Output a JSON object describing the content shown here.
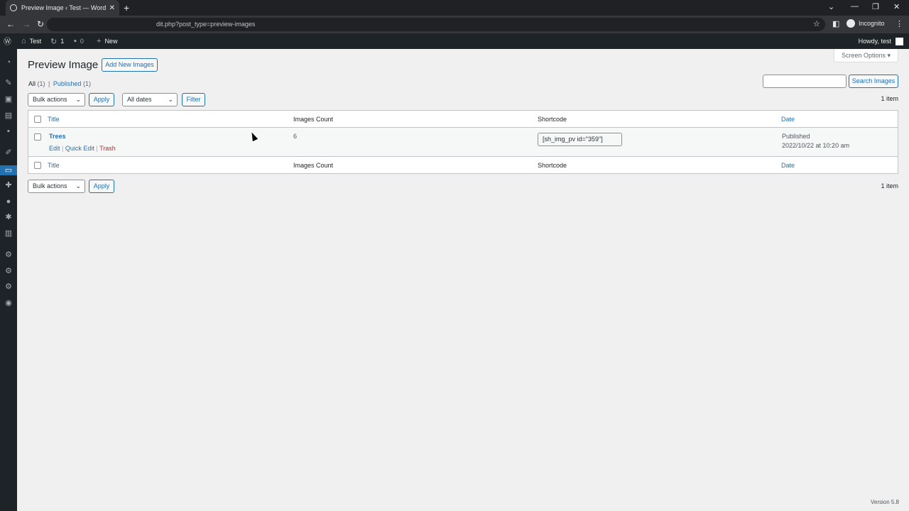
{
  "browser": {
    "tab_title": "Preview Image ‹ Test — WordPre",
    "url": "dit.php?post_type=preview-images",
    "profile": "Incognito"
  },
  "adminbar": {
    "site_name": "Test",
    "updates_count": "1",
    "comments_count": "0",
    "new_label": "New",
    "howdy": "Howdy, test"
  },
  "screen_options": "Screen Options ▾",
  "page": {
    "title": "Preview Image",
    "add_new": "Add New Images"
  },
  "filters": {
    "all": "All",
    "all_count": "(1)",
    "sep": "|",
    "published": "Published",
    "published_count": "(1)",
    "search_button": "Search Images",
    "bulk_actions": "Bulk actions",
    "apply": "Apply",
    "all_dates": "All dates",
    "filter": "Filter",
    "item_count": "1 item"
  },
  "table": {
    "columns": {
      "title": "Title",
      "images_count": "Images Count",
      "shortcode": "Shortcode",
      "date": "Date"
    },
    "rows": [
      {
        "title": "Trees",
        "images_count": "6",
        "shortcode": "[sh_img_pv id=\"359\"]",
        "status": "Published",
        "date": "2022/10/22 at 10:20 am",
        "actions": {
          "edit": "Edit",
          "quick_edit": "Quick Edit",
          "trash": "Trash",
          "sep": "|"
        }
      }
    ]
  },
  "footer": {
    "version": "Version 5.8"
  }
}
